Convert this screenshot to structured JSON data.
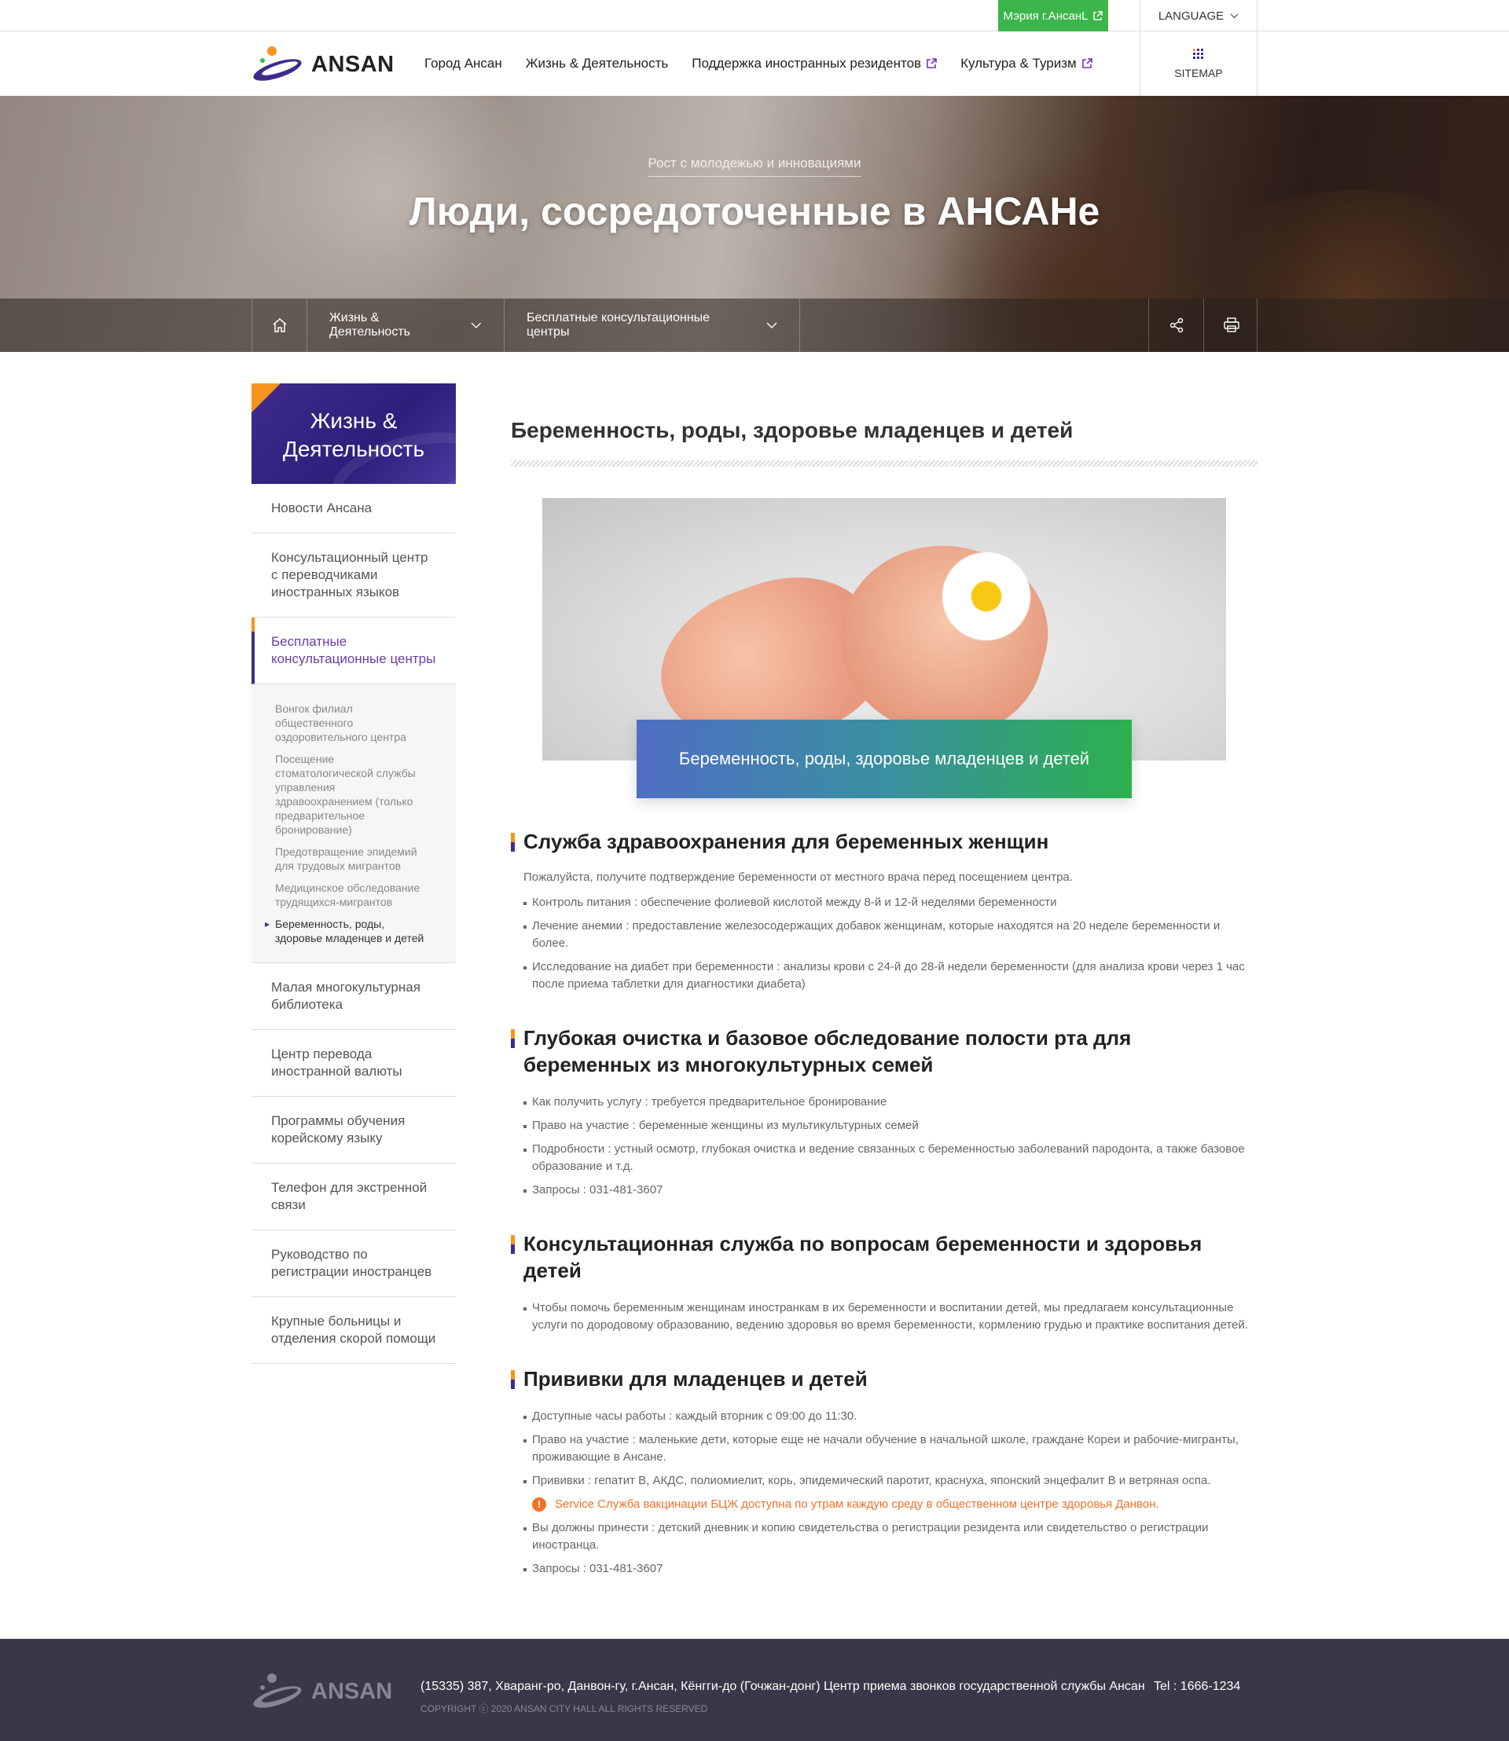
{
  "topbar": {
    "city_hall_label": "Мэрия г.АнсанL",
    "language_label": "LANGUAGE"
  },
  "header": {
    "logo_text": "ANSAN",
    "nav": [
      {
        "label": "Город Ансан",
        "external": false
      },
      {
        "label": "Жизнь & Деятельность",
        "external": false
      },
      {
        "label": "Поддержка иностранных резидентов",
        "external": true
      },
      {
        "label": "Культура & Туризм",
        "external": true
      }
    ],
    "sitemap_label": "SITEMAP"
  },
  "hero": {
    "subtitle": "Рост с молодежью и инновациями",
    "title": "Люди, сосредоточенные в АНСАНе"
  },
  "breadcrumb": {
    "level1": "Жизнь & Деятельность",
    "level2": "Бесплатные консультационные центры"
  },
  "sidebar": {
    "title": "Жизнь & Деятельность",
    "items": [
      {
        "label": "Новости Ансана"
      },
      {
        "label": "Консультационный центр с переводчиками иностранных языков"
      },
      {
        "label": "Бесплатные консультационные центры",
        "active": true
      },
      {
        "label": "Малая многокультурная библиотека"
      },
      {
        "label": "Центр перевода иностранной валюты"
      },
      {
        "label": "Программы обучения корейскому языку"
      },
      {
        "label": "Телефон для экстренной связи"
      },
      {
        "label": "Руководство по регистрации иностранцев"
      },
      {
        "label": "Крупные больницы и отделения скорой помощи"
      }
    ],
    "submenu": [
      {
        "label": "Вонгок филиал общественного оздоровительного центра"
      },
      {
        "label": "Посещение стоматологической службы управления здравоохранением (только предварительное бронирование)"
      },
      {
        "label": "Предотвращение эпидемий для трудовых мигрантов"
      },
      {
        "label": "Медицинское обследование трудящихся-мигрантов"
      },
      {
        "label": "Беременность, роды, здоровье младенцев и детей",
        "current": true
      }
    ]
  },
  "content": {
    "page_title": "Беременность, роды, здоровье младенцев и детей",
    "photo_caption": "Беременность, роды, здоровье младенцев и детей",
    "sections": [
      {
        "title": "Служба здравоохранения для беременных женщин",
        "intro": "Пожалуйста, получите подтверждение беременности от местного врача перед посещением центра.",
        "items": [
          "Контроль питания : обеспечение фолиевой кислотой между 8-й и 12-й неделями беременности",
          "Лечение анемии : предоставление железосодержащих добавок женщинам, которые находятся на 20 неделе беременности и более.",
          "Исследование на диабет при беременности : анализы крови с 24-й до 28-й недели беременности (для анализа крови через 1 час после приема таблетки для диагностики диабета)"
        ]
      },
      {
        "title": "Глубокая очистка и базовое обследование полости рта для беременных из многокультурных семей",
        "items": [
          "Как получить услугу : требуется предварительное бронирование",
          "Право на участие : беременные женщины из мультикультурных семей",
          "Подробности : устный осмотр, глубокая очистка и ведение связанных с беременностью заболеваний пародонта, а также базовое образование и т.д.",
          "Запросы : 031-481-3607"
        ]
      },
      {
        "title": "Консультационная служба по вопросам беременности и здоровья детей",
        "items": [
          "Чтобы помочь беременным женщинам иностранкам в их беременности и воспитании детей, мы предлагаем консультационные услуги по дородовому образованию, ведению здоровья во время беременности, кормлению грудью и практике воспитания детей."
        ]
      },
      {
        "title": "Прививки для младенцев и детей",
        "items": [
          "Доступные часы работы : каждый вторник с 09:00 до 11:30.",
          "Право на участие : маленькие дети, которые еще не начали обучение в начальной школе, граждане Кореи и рабочие-мигранты, проживающие в Ансане.",
          "Прививки : гепатит B, АКДС, полиомиелит, корь, эпидемический паротит, краснуха, японский энцефалит B и ветряная оспа."
        ],
        "notice": "Service Служба вакцинации БЦЖ доступна по утрам каждую среду в общественном центре здоровья Данвон.",
        "items_after": [
          "Вы должны принести : детский дневник и копию свидетельства о регистрации резидента или свидетельство о регистрации иностранца.",
          "Запросы : 031-481-3607"
        ]
      }
    ]
  },
  "footer": {
    "logo_text": "ANSAN",
    "address": "(15335) 387, Хваранг-ро, Данвон-гу, г.Ансан, Кёнгги-до (Гочжан-донг) Центр приема звонков государственной службы Ансан",
    "tel": "Tel : 1666-1234",
    "copyright": "COPYRIGHT ⓒ 2020 ANSAN CITY HALL ALL RIGHTS RESERVED"
  },
  "colors": {
    "brand_purple": "#3f2b8c",
    "accent_orange": "#f7941d",
    "city_hall_green": "#3cb54a",
    "notice_orange": "#f2712a",
    "footer_bg": "#3a3748"
  }
}
